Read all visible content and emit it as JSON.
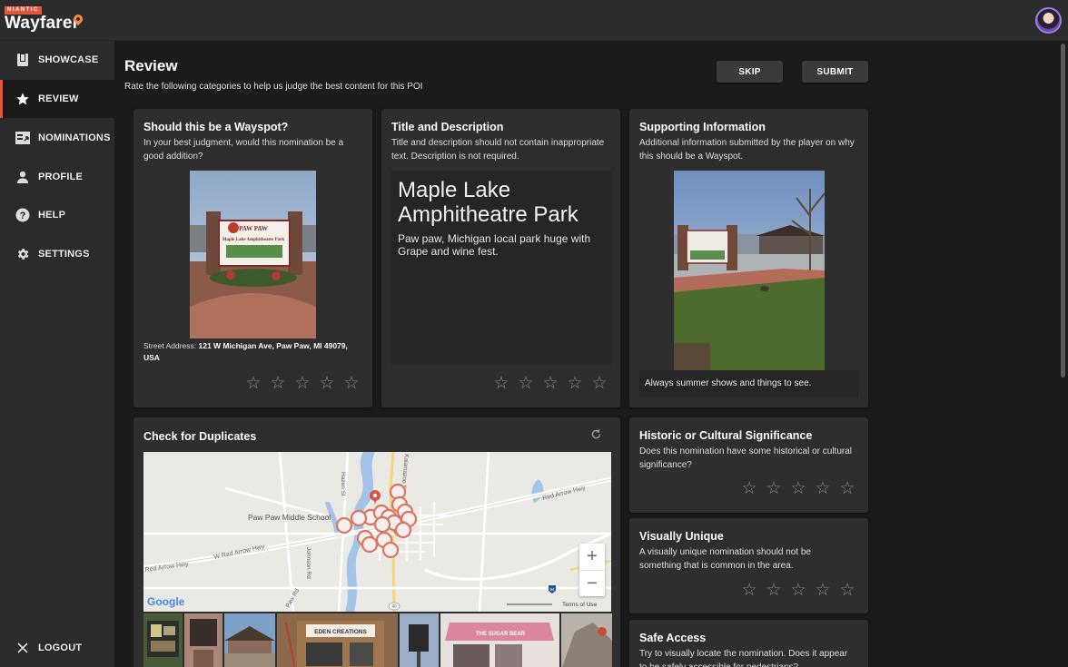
{
  "brand": {
    "niantic": "NIANTIC",
    "wordmark": "Wayfarer"
  },
  "nav": [
    {
      "label": "SHOWCASE",
      "icon": "showcase-icon"
    },
    {
      "label": "REVIEW",
      "icon": "star-icon",
      "active": true
    },
    {
      "label": "NOMINATIONS",
      "icon": "nominations-icon"
    },
    {
      "label": "PROFILE",
      "icon": "person-icon"
    },
    {
      "label": "HELP",
      "icon": "help-icon"
    },
    {
      "label": "SETTINGS",
      "icon": "gear-icon"
    }
  ],
  "logout": "LOGOUT",
  "header": {
    "title": "Review",
    "subtitle": "Rate the following categories to help us judge the best content for this POI",
    "skip": "SKIP",
    "submit": "SUBMIT"
  },
  "wayspot": {
    "title": "Should this be a Wayspot?",
    "desc": "In your best judgment, would this nomination be a good addition?",
    "address_label": "Street Address:",
    "address": "121 W Michigan Ave, Paw Paw, MI 49079, USA",
    "sign_line1": "PAW PAW",
    "sign_line2": "Maple Lake Amphitheatre Park"
  },
  "title_desc": {
    "title": "Title and Description",
    "desc": "Title and description should not contain inappropriate text. Description is not required.",
    "poi_title": "Maple Lake Amphitheatre Park",
    "poi_desc": "Paw paw, Michigan local park huge with Grape and wine fest."
  },
  "supporting": {
    "title": "Supporting Information",
    "desc": "Additional information submitted by the player on why this should be a Wayspot.",
    "text": "Always summer shows and things to see."
  },
  "duplicates": {
    "title": "Check for Duplicates",
    "map_labels": {
      "school": "Paw Paw Middle School",
      "red_arrow_e": "Red Arrow Hwy",
      "red_arrow_w": "W Red Arrow Hwy",
      "red_arrow_sw": "Red Arrow Hwy",
      "hazen": "Hazen St",
      "johnson": "Johnson Rd",
      "paw_rd": "Paw Rd",
      "kalamazoo": "Kalamazoo St",
      "route": "40",
      "interstate": "94"
    },
    "google": "Google",
    "terms": "Terms of Use",
    "zoom_in": "+",
    "zoom_out": "−",
    "thumb_sign": "EDEN CREATIONS",
    "thumb_shop": "THE SUGAR BEAR"
  },
  "historic": {
    "title": "Historic or Cultural Significance",
    "desc": "Does this nomination have some historical or cultural significance?"
  },
  "visual": {
    "title": "Visually Unique",
    "desc": "A visually unique nomination should not be something that is common in the area."
  },
  "safe": {
    "title": "Safe Access",
    "desc": "Try to visually locate the nomination. Does it appear to be safely accessible for pedestrians?"
  },
  "star_glyph": "☆",
  "colors": {
    "accent": "#e8553d",
    "card": "#2e2e2e",
    "background": "#1b1b1b"
  }
}
